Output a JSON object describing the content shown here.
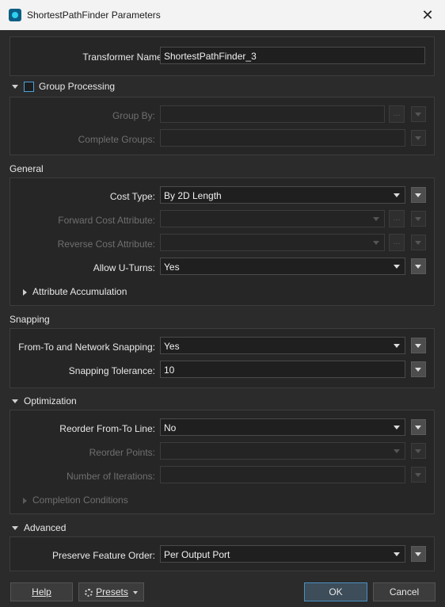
{
  "window": {
    "title": "ShortestPathFinder Parameters"
  },
  "transformer": {
    "label": "Transformer Name:",
    "value": "ShortestPathFinder_3"
  },
  "group_processing": {
    "title": "Group Processing",
    "group_by": {
      "label": "Group By:",
      "value": ""
    },
    "complete_groups": {
      "label": "Complete Groups:",
      "value": ""
    }
  },
  "general": {
    "title": "General",
    "cost_type": {
      "label": "Cost Type:",
      "value": "By 2D Length"
    },
    "forward_cost": {
      "label": "Forward Cost Attribute:",
      "value": ""
    },
    "reverse_cost": {
      "label": "Reverse Cost Attribute:",
      "value": ""
    },
    "allow_uturns": {
      "label": "Allow U-Turns:",
      "value": "Yes"
    },
    "attribute_accumulation": "Attribute Accumulation"
  },
  "snapping": {
    "title": "Snapping",
    "network_snapping": {
      "label": "From-To and Network Snapping:",
      "value": "Yes"
    },
    "tolerance": {
      "label": "Snapping Tolerance:",
      "value": "10"
    }
  },
  "optimization": {
    "title": "Optimization",
    "reorder_line": {
      "label": "Reorder From-To Line:",
      "value": "No"
    },
    "reorder_points": {
      "label": "Reorder Points:",
      "value": ""
    },
    "iterations": {
      "label": "Number of Iterations:",
      "value": ""
    },
    "completion_conditions": "Completion Conditions"
  },
  "advanced": {
    "title": "Advanced",
    "preserve_order": {
      "label": "Preserve Feature Order:",
      "value": "Per Output Port"
    }
  },
  "footer": {
    "help": "Help",
    "presets": "Presets",
    "ok": "OK",
    "cancel": "Cancel"
  },
  "icons": {
    "app": "shortestpathfinder-icon",
    "close": "close-icon",
    "presets": "gear-icon"
  }
}
